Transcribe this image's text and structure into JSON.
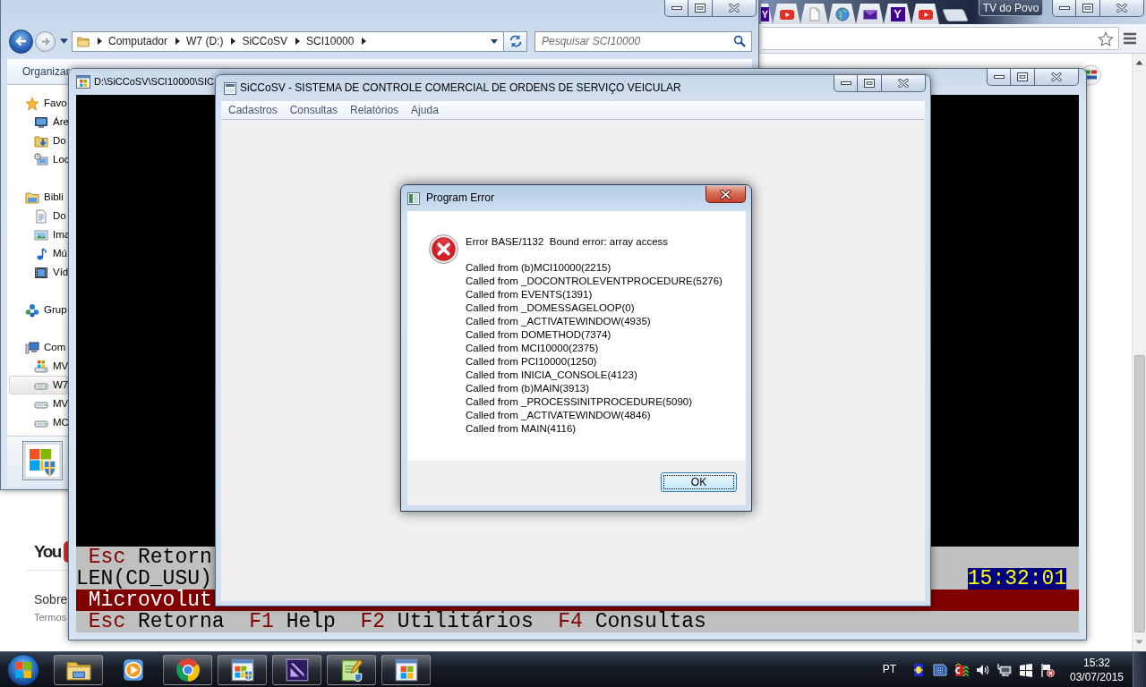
{
  "browser_window": {
    "tabs": [
      {
        "kind": "letter",
        "letter": "Y"
      },
      {
        "kind": "video"
      },
      {
        "kind": "page"
      },
      {
        "kind": "globe"
      },
      {
        "kind": "mail"
      },
      {
        "kind": "letter",
        "letter": "Y"
      },
      {
        "kind": "video"
      }
    ],
    "profile_label": "TV do Povo",
    "page": {
      "logo_text": "You",
      "links": [
        "Sobre",
        "Termos"
      ]
    }
  },
  "explorer_window": {
    "back_button": {
      "disabled": false
    },
    "forward_button": {
      "disabled": true
    },
    "breadcrumb": [
      "Computador",
      "W7 (D:)",
      "SiCCoSV",
      "SCI10000"
    ],
    "search": {
      "placeholder": "Pesquisar SCI10000"
    },
    "toolbar": [
      "Organizar"
    ],
    "nav_tree": [
      {
        "label": "Favo",
        "kind": "favorites",
        "selected": false,
        "children": [
          {
            "label": "Áre",
            "kind": "desktop",
            "selected": false
          },
          {
            "label": "Do",
            "kind": "downloads",
            "selected": false
          },
          {
            "label": "Loc",
            "kind": "places",
            "selected": false
          }
        ]
      },
      {
        "label": "Bibli",
        "kind": "libraries",
        "selected": false,
        "children": [
          {
            "label": "Do",
            "kind": "documents",
            "selected": false
          },
          {
            "label": "Ima",
            "kind": "pictures",
            "selected": false
          },
          {
            "label": "Mú",
            "kind": "music",
            "selected": false
          },
          {
            "label": "Víd",
            "kind": "videos",
            "selected": false
          }
        ]
      },
      {
        "label": "Grup",
        "kind": "homegroup",
        "selected": false
      },
      {
        "label": "Com",
        "kind": "computer",
        "selected": false,
        "children": [
          {
            "label": "MV",
            "kind": "system-drive",
            "selected": false
          },
          {
            "label": "W7",
            "kind": "drive",
            "selected": true
          },
          {
            "label": "MV",
            "kind": "drive",
            "selected": false
          },
          {
            "label": "MC",
            "kind": "drive",
            "selected": false
          }
        ]
      }
    ]
  },
  "console_window": {
    "title": "D:\\SiCCoSV\\SCI10000\\SIC",
    "lines": [
      {
        "kind": "keys",
        "keys": [
          {
            "key": "Esc",
            "label": "Retorn"
          }
        ]
      },
      {
        "kind": "status",
        "text": "LEN(CD_USU)",
        "clock": "15:32:01"
      },
      {
        "kind": "banner",
        "text": "Microvolut"
      },
      {
        "kind": "keys",
        "keys": [
          {
            "key": "Esc",
            "label": "Retorna"
          },
          {
            "key": "F1",
            "label": "Help"
          },
          {
            "key": "F2",
            "label": "Utilitários"
          },
          {
            "key": "F4",
            "label": "Consultas"
          }
        ]
      }
    ]
  },
  "main_window": {
    "title": "SiCCoSV - SISTEMA DE CONTROLE COMERCIAL DE ORDENS DE SERVIÇO VEICULAR",
    "menu": [
      "Cadastros",
      "Consultas",
      "Relatórios",
      "Ajuda"
    ]
  },
  "error_dialog": {
    "title": "Program Error",
    "message": "Error BASE/1132  Bound error: array access",
    "call_stack": [
      "Called from (b)MCI10000(2215)",
      "Called from _DOCONTROLEVENTPROCEDURE(5276)",
      "Called from EVENTS(1391)",
      "Called from _DOMESSAGELOOP(0)",
      "Called from _ACTIVATEWINDOW(4935)",
      "Called from DOMETHOD(7374)",
      "Called from MCI10000(2375)",
      "Called from PCI10000(1250)",
      "Called from INICIA_CONSOLE(4123)",
      "Called from (b)MAIN(3913)",
      "Called from _PROCESSINITPROCEDURE(5090)",
      "Called from _ACTIVATEWINDOW(4846)",
      "Called from MAIN(4116)"
    ],
    "buttons": [
      {
        "label": "OK",
        "focused": true
      }
    ]
  },
  "taskbar": {
    "apps": [
      {
        "kind": "folder",
        "running": true
      },
      {
        "kind": "media",
        "running": false
      },
      {
        "kind": "browser",
        "running": true
      },
      {
        "kind": "setup",
        "running": true
      },
      {
        "kind": "studio",
        "running": true
      },
      {
        "kind": "notepad",
        "running": true
      },
      {
        "kind": "window",
        "running": true
      }
    ],
    "language": "PT",
    "time": "15:32",
    "date": "03/07/2015"
  }
}
